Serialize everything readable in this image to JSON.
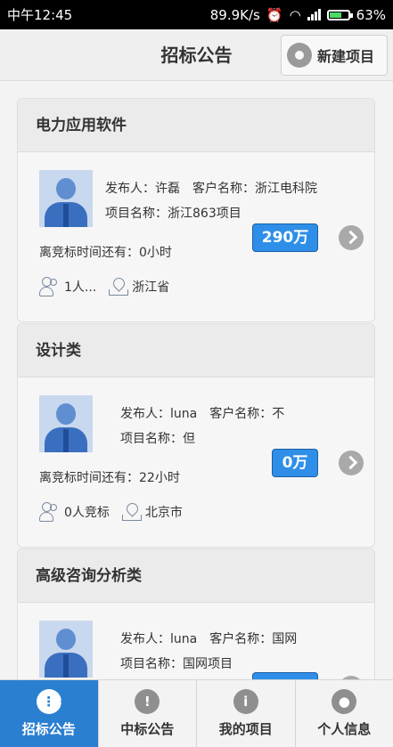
{
  "status_bar": {
    "time": "中午12:45",
    "speed": "89.9K/s",
    "battery": "63%"
  },
  "header": {
    "title": "招标公告",
    "new_button": "新建项目"
  },
  "colors": {
    "accent": "#2b7fd0",
    "price_bg": "#2f8fe8"
  },
  "cards": [
    {
      "category": "电力应用软件",
      "publisher": "发布人：许磊",
      "client": "客户名称：浙江电科院",
      "project": "项目名称：浙江863项目",
      "deadline": "离竞标时间还有：0小时",
      "price": "290万",
      "bidders": "1人...",
      "location": "浙江省"
    },
    {
      "category": "设计类",
      "publisher": "发布人：luna",
      "client": "客户名称：不",
      "project": "项目名称：但",
      "deadline": "离竞标时间还有：22小时",
      "price": "0万",
      "bidders": "0人竞标",
      "location": "北京市"
    },
    {
      "category": "高级咨询分析类",
      "publisher": "发布人：luna",
      "client": "客户名称：国网",
      "project": "项目名称：国网项目",
      "deadline": "",
      "price": "",
      "bidders": "",
      "location": ""
    }
  ],
  "tabs": [
    {
      "label": "招标公告",
      "icon": "grid-icon"
    },
    {
      "label": "中标公告",
      "icon": "alert-icon"
    },
    {
      "label": "我的项目",
      "icon": "info-icon"
    },
    {
      "label": "个人信息",
      "icon": "user-icon"
    }
  ]
}
